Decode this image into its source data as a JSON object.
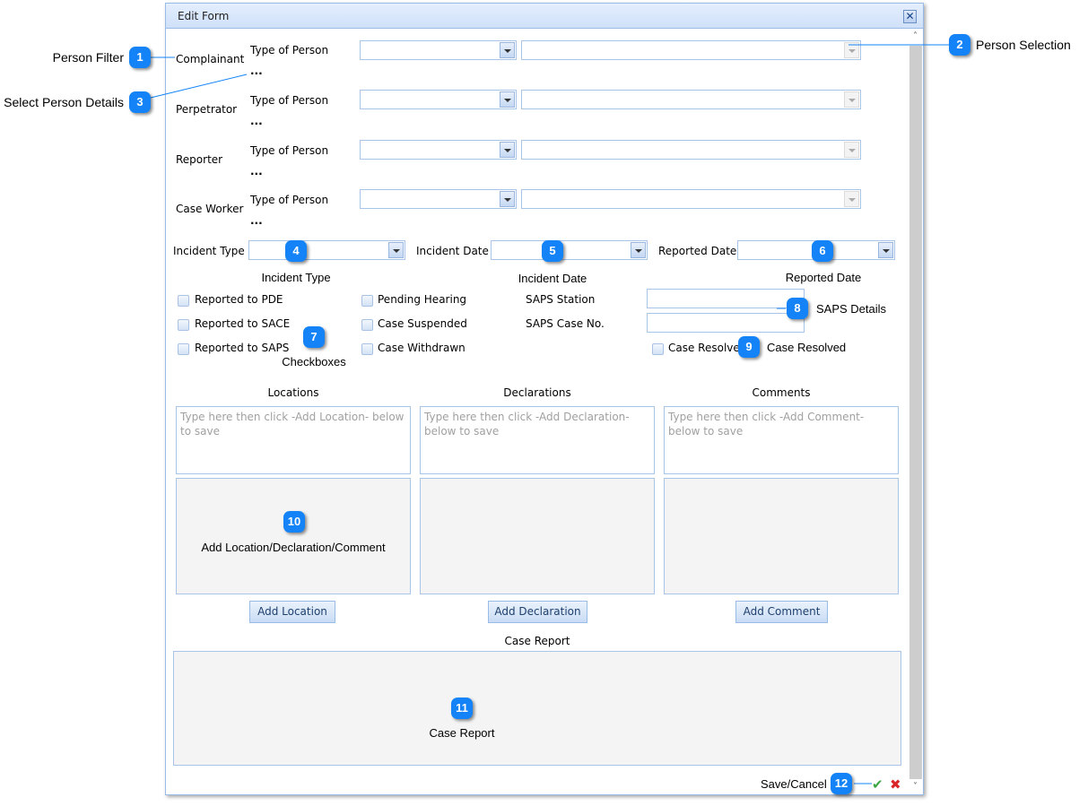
{
  "window": {
    "title": "Edit Form",
    "close_icon": "close-icon (x)"
  },
  "persons": [
    {
      "role": "Complainant",
      "type_label": "Type of Person",
      "details": "..."
    },
    {
      "role": "Perpetrator",
      "type_label": "Type of Person",
      "details": "..."
    },
    {
      "role": "Reporter",
      "type_label": "Type of Person",
      "details": "..."
    },
    {
      "role": "Case Worker",
      "type_label": "Type of Person",
      "details": "..."
    }
  ],
  "incident": {
    "type_label": "Incident Type",
    "type_value": "",
    "date_label": "Incident Date",
    "date_value": "",
    "reported_label": "Reported Date",
    "reported_value": ""
  },
  "checkboxes": {
    "col1": [
      {
        "label": "Reported to PDE",
        "checked": false
      },
      {
        "label": "Reported to SACE",
        "checked": false
      },
      {
        "label": "Reported to SAPS",
        "checked": false
      }
    ],
    "col2": [
      {
        "label": "Pending Hearing",
        "checked": false
      },
      {
        "label": "Case Suspended",
        "checked": false
      },
      {
        "label": "Case Withdrawn",
        "checked": false
      }
    ],
    "case_resolved": {
      "label": "Case Resolved",
      "checked": false
    }
  },
  "saps": {
    "station_label": "SAPS Station",
    "station_value": "",
    "case_no_label": "SAPS Case No.",
    "case_no_value": ""
  },
  "panels": [
    {
      "title": "Locations",
      "placeholder": "Type here then click -Add Location- below to save",
      "button": "Add Location"
    },
    {
      "title": "Declarations",
      "placeholder": "Type here then click -Add Declaration- below to save",
      "button": "Add Declaration"
    },
    {
      "title": "Comments",
      "placeholder": "Type here then click -Add Comment- below to save",
      "button": "Add Comment"
    }
  ],
  "case_report": {
    "title": "Case Report"
  },
  "footer": {
    "save_icon": "checkmark-icon",
    "cancel_icon": "x-icon"
  },
  "callouts": [
    {
      "num": "1",
      "text": "Person Filter"
    },
    {
      "num": "2",
      "text": "Person Selection"
    },
    {
      "num": "3",
      "text": "Select Person Details"
    },
    {
      "num": "4",
      "text": "Incident Type"
    },
    {
      "num": "5",
      "text": "Incident Date"
    },
    {
      "num": "6",
      "text": "Reported Date"
    },
    {
      "num": "7",
      "text": "Checkboxes"
    },
    {
      "num": "8",
      "text": "SAPS Details"
    },
    {
      "num": "9",
      "text": "Case Resolved"
    },
    {
      "num": "10",
      "text": "Add Location/Declaration/Comment"
    },
    {
      "num": "11",
      "text": "Case Report"
    },
    {
      "num": "12",
      "text": "Save/Cancel"
    }
  ],
  "colors": {
    "accent": "#1383f7",
    "border": "#99bbe8",
    "title_bg": "#dbe8fb"
  }
}
